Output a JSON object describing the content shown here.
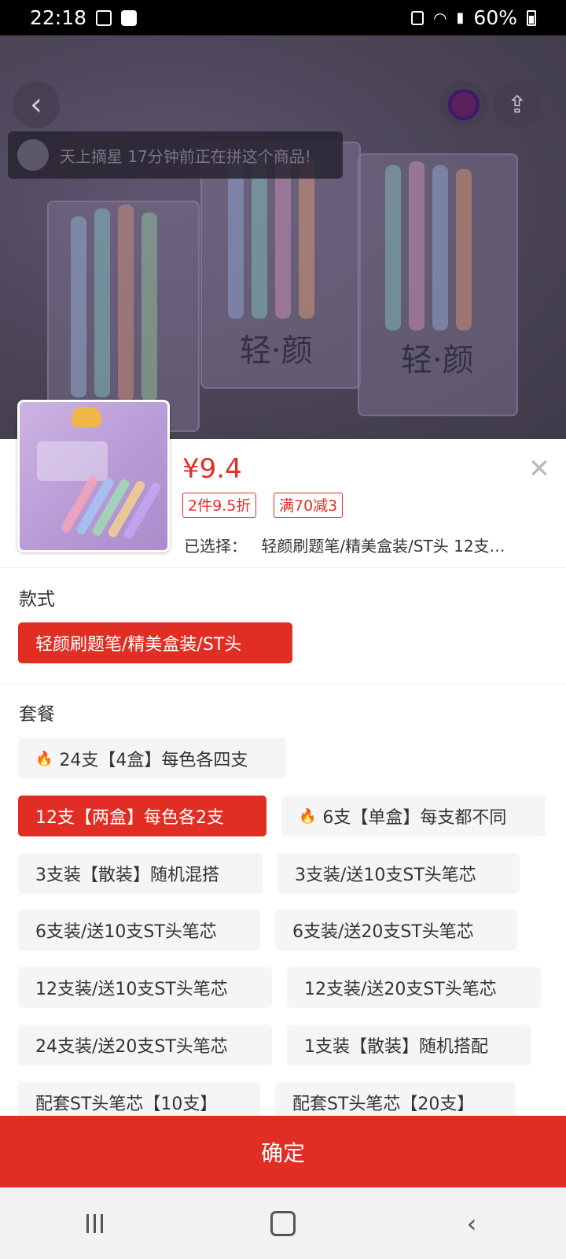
{
  "status_bar": {
    "time": "22:18",
    "battery_text": "60%",
    "icons": [
      "image-icon",
      "clock-app-icon",
      "data-saver-icon",
      "wifi-icon",
      "signal-icon",
      "battery-icon"
    ]
  },
  "hero": {
    "notice_text": "天上摘星 17分钟前正在拼这个商品!",
    "box_title_left": "轻·颜",
    "box_title_right": "轻·颜"
  },
  "product": {
    "price": "¥9.4",
    "tags": [
      "2件9.5折",
      "满70减3"
    ],
    "selected_label": "已选择：",
    "selected_value": "轻颜刷题笔/精美盒装/ST头 12支…",
    "close_label": "✕"
  },
  "style_section": {
    "title": "款式",
    "options": [
      {
        "label": "轻颜刷题笔/精美盒装/ST头",
        "active": true
      }
    ]
  },
  "package_section": {
    "title": "套餐",
    "options": [
      {
        "label": "24支【4盒】每色各四支",
        "hot": true,
        "active": false
      },
      {
        "label": "12支【两盒】每色各2支",
        "hot": false,
        "active": true
      },
      {
        "label": "6支【单盒】每支都不同",
        "hot": true,
        "active": false
      },
      {
        "label": "3支装【散装】随机混搭",
        "hot": false,
        "active": false
      },
      {
        "label": "3支装/送10支ST头笔芯",
        "hot": false,
        "active": false
      },
      {
        "label": "6支装/送10支ST头笔芯",
        "hot": false,
        "active": false
      },
      {
        "label": "6支装/送20支ST头笔芯",
        "hot": false,
        "active": false
      },
      {
        "label": "12支装/送10支ST头笔芯",
        "hot": false,
        "active": false
      },
      {
        "label": "12支装/送20支ST头笔芯",
        "hot": false,
        "active": false
      },
      {
        "label": "24支装/送20支ST头笔芯",
        "hot": false,
        "active": false
      },
      {
        "label": "1支装【散装】随机搭配",
        "hot": false,
        "active": false
      },
      {
        "label": "配套ST头笔芯【10支】",
        "hot": false,
        "active": false
      },
      {
        "label": "配套ST头笔芯【20支】",
        "hot": false,
        "active": false
      }
    ]
  },
  "confirm_button": "确定",
  "colors": {
    "accent": "#e02e24",
    "chip_bg": "#f5f5f5"
  }
}
